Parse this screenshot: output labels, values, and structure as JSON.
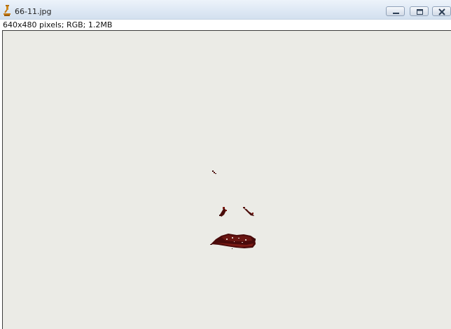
{
  "window": {
    "title": "66-11.jpg",
    "icon": "microscope-icon",
    "controls": {
      "minimize_icon": "minimize-icon",
      "maximize_icon": "maximize-icon",
      "close_icon": "close-icon"
    }
  },
  "image_info": "640x480 pixels; RGB; 1.2MB",
  "colors": {
    "titlebar": "#dfe9f5",
    "canvas_background": "#ebebe6",
    "blob_dark": "#3a0a0a",
    "blob_red": "#7a1a12"
  }
}
